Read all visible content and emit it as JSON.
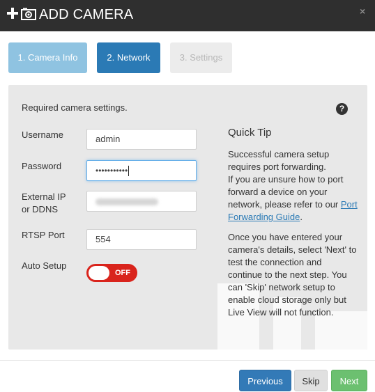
{
  "window": {
    "title": "ADD CAMERA",
    "close_label": "×"
  },
  "steps": [
    {
      "label": "1. Camera Info",
      "state": "completed"
    },
    {
      "label": "2. Network",
      "state": "active"
    },
    {
      "label": "3. Settings",
      "state": "disabled"
    }
  ],
  "form": {
    "required_text": "Required camera settings.",
    "help_label": "?",
    "username": {
      "label": "Username",
      "value": "admin"
    },
    "password": {
      "label": "Password",
      "value": "•••••••••••"
    },
    "external_ip": {
      "label_line1": "External IP",
      "label_line2": "or DDNS",
      "value_blurred": true
    },
    "rtsp_port": {
      "label": "RTSP Port",
      "value": "554"
    },
    "auto_setup": {
      "label": "Auto Setup",
      "state": "OFF"
    }
  },
  "quick_tip": {
    "title": "Quick Tip",
    "p1_line1": "Successful camera setup",
    "p1_line2": "requires port forwarding.",
    "p1_line3": "If you are unsure how to port",
    "p1_line4": "forward a device on your",
    "p1_line5_prefix": "network, please refer to our",
    "p1_link_part1": "Port",
    "p1_link_part2": "Forwarding Guide",
    "p1_suffix": ".",
    "p2_line1": "Once you have entered your",
    "p2_line2": "camera's details, select 'Next' to",
    "p2_line3": "test the connection and",
    "p2_line4": "continue to the next step. You",
    "p2_line5": "can 'Skip' network setup to",
    "p2_line6": "enable cloud storage only but",
    "p2_line7": "Live View will not function."
  },
  "footer": {
    "previous_label": "Previous",
    "skip_label": "Skip",
    "next_label": "Next"
  },
  "colors": {
    "titlebar": "#2f2f2f",
    "step_completed": "#8fc3e1",
    "step_active": "#2b7ab5",
    "step_disabled": "#ececec",
    "toggle_off": "#d9241c",
    "previous_button": "#337ab7",
    "next_button": "#6cc070",
    "link": "#2b7ab5"
  },
  "icons": [
    "plus-icon",
    "camera-icon",
    "close-icon",
    "help-icon"
  ]
}
